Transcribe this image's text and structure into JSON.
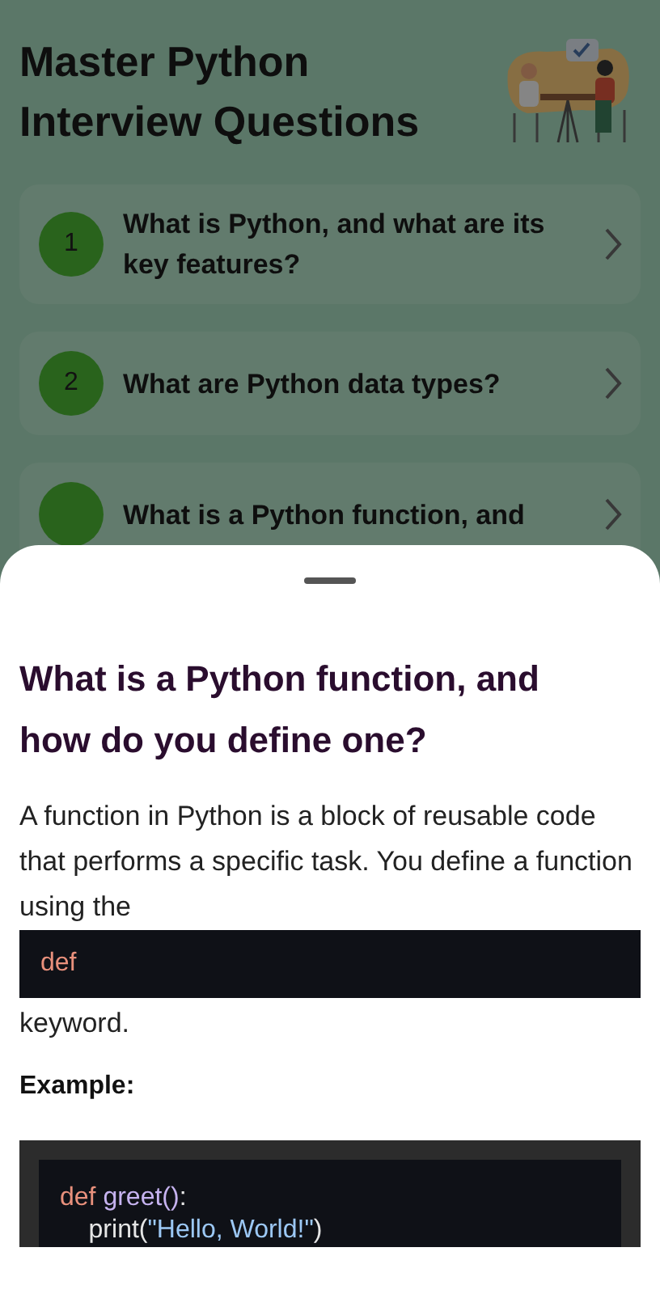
{
  "header": {
    "title": "Master Python Interview Questions"
  },
  "questions": [
    {
      "number": "1",
      "text": "What is Python, and what are its key features?"
    },
    {
      "number": "2",
      "text": "What are Python data types?"
    },
    {
      "text": "What is a Python function, and"
    }
  ],
  "sheet": {
    "title": "What is a Python function, and how do you define one?",
    "paragraph": "A function in Python is a block of reusable code that performs a specific task. You define a function using the",
    "inline_code": "def",
    "after_text": "keyword.",
    "example_label": "Example:",
    "code_lines": [
      [
        {
          "kind": "keyword",
          "text": "def"
        },
        {
          "kind": "name",
          "text": " greet()"
        },
        {
          "kind": "plain",
          "text": ":"
        }
      ],
      [
        {
          "kind": "plain",
          "text": "    print("
        },
        {
          "kind": "string",
          "text": "\"Hello, World!\""
        },
        {
          "kind": "plain",
          "text": ")"
        }
      ]
    ]
  }
}
